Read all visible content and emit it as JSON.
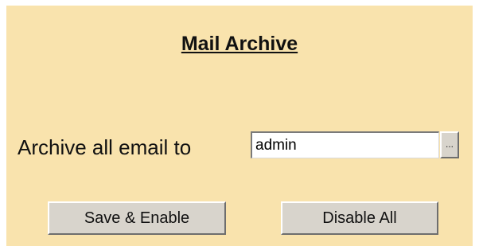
{
  "title": "Mail Archive",
  "archive": {
    "label": "Archive all email to",
    "value": "admin",
    "browse_label": "..."
  },
  "buttons": {
    "save_enable": "Save & Enable",
    "disable_all": "Disable All"
  },
  "colors": {
    "panel_background": "#f9e3ad",
    "button_face": "#d8d4cc"
  }
}
